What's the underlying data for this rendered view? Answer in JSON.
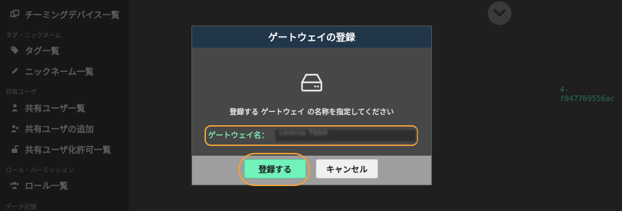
{
  "sidebar": {
    "items": [
      {
        "label": "チーミングデバイス一覧",
        "icon": "devices-icon"
      },
      {
        "label": "タグ一覧",
        "icon": "tags-icon"
      },
      {
        "label": "ニックネーム一覧",
        "icon": "pencil-icon"
      },
      {
        "label": "共有ユーザ一覧",
        "icon": "user-icon"
      },
      {
        "label": "共有ユーザの追加",
        "icon": "user-plus-icon"
      },
      {
        "label": "共有ユーザ化許可一覧",
        "icon": "unlock-icon"
      },
      {
        "label": "ロール一覧",
        "icon": "users-icon"
      }
    ],
    "sections": [
      "タグ・ニックネーム",
      "共有ユーザ",
      "ロール・パーミッション",
      "データ記録"
    ]
  },
  "background": {
    "id_fragment": "4-f047769556ac"
  },
  "modal": {
    "title": "ゲートウェイの登録",
    "icon": "hard-drive-icon",
    "instruction": "登録する ゲートウェイ の名称を指定してください",
    "field_label": "ゲートウェイ名：",
    "field_value": "Lorenzy Tibbit",
    "register_label": "登録する",
    "cancel_label": "キャンセル"
  },
  "colors": {
    "header": "#22364a",
    "accent_green": "#71f2bb",
    "highlight_orange": "#f2a33a",
    "label_green": "#7fe7b3"
  }
}
